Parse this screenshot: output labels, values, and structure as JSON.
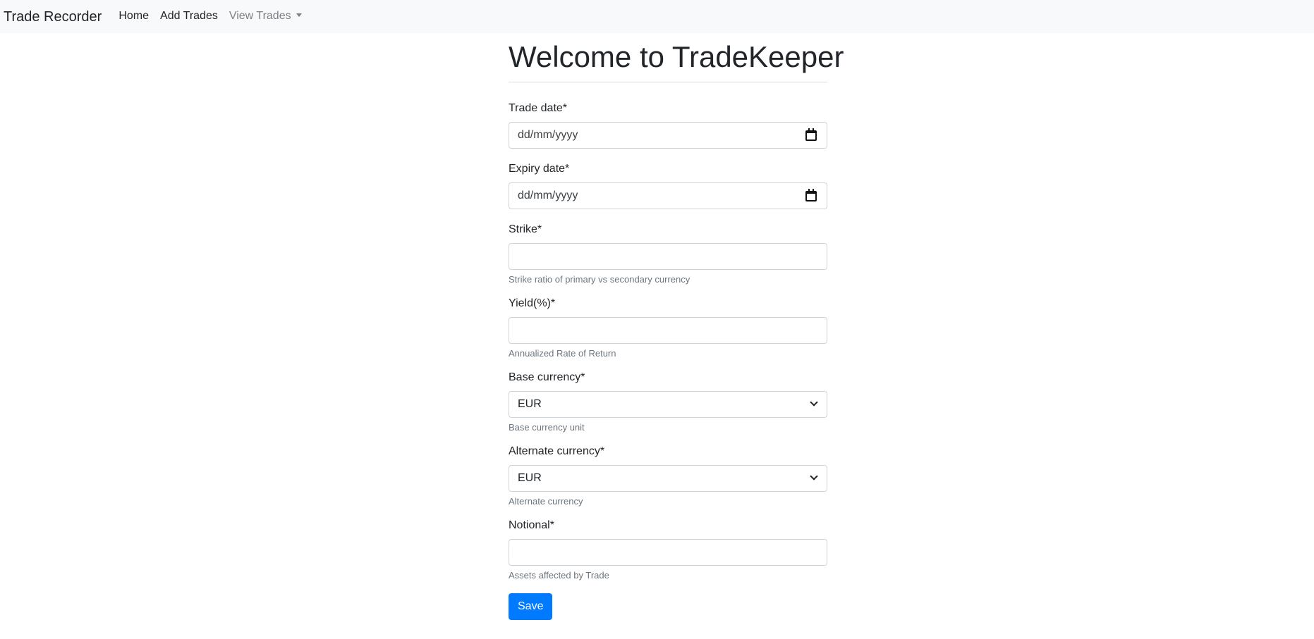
{
  "navbar": {
    "brand": "Trade Recorder",
    "links": [
      {
        "label": "Home"
      },
      {
        "label": "Add Trades"
      },
      {
        "label": "View Trades"
      }
    ]
  },
  "page": {
    "title": "Welcome to TradeKeeper"
  },
  "form": {
    "trade_date": {
      "label": "Trade date*",
      "placeholder": "dd/mm/yyyy"
    },
    "expiry_date": {
      "label": "Expiry date*",
      "placeholder": "dd/mm/yyyy"
    },
    "strike": {
      "label": "Strike*",
      "value": "",
      "help": "Strike ratio of primary vs secondary currency"
    },
    "yield": {
      "label": "Yield(%)*",
      "value": "",
      "help": "Annualized Rate of Return"
    },
    "base_currency": {
      "label": "Base currency*",
      "selected": "EUR",
      "help": "Base currency unit"
    },
    "alternate_currency": {
      "label": "Alternate currency*",
      "selected": "EUR",
      "help": "Alternate currency"
    },
    "notional": {
      "label": "Notional*",
      "value": "",
      "help": "Assets affected by Trade"
    },
    "save_label": "Save"
  },
  "icons": {
    "date_picker": "calendar-icon",
    "select": "chevron-down-icon",
    "dropdown": "caret-down-icon"
  },
  "colors": {
    "primary": "#007bff",
    "navbar_bg": "#f8f9fa",
    "muted_text": "#6c757d"
  }
}
